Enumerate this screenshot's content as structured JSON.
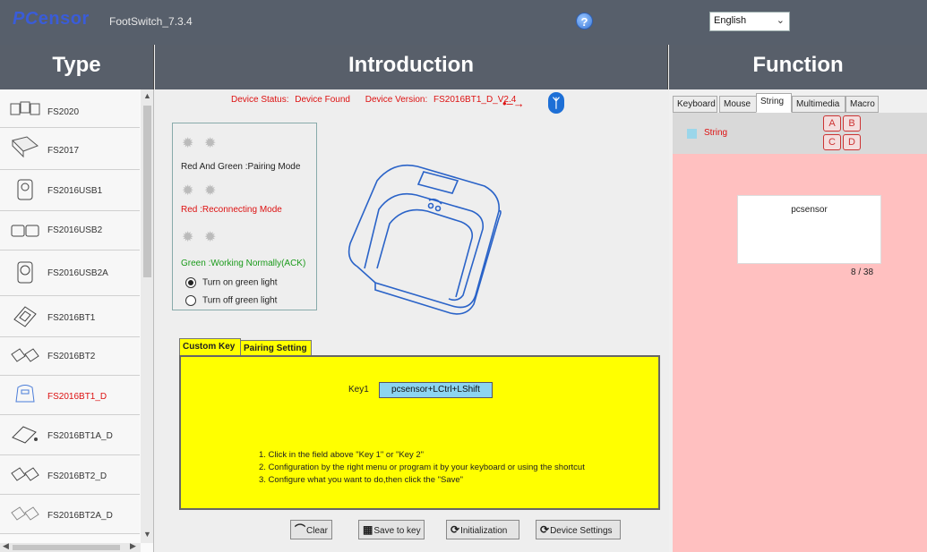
{
  "titlebar": {
    "logo_pc": "PC",
    "logo_rest": "ensor",
    "app_title": "FootSwitch_7.3.4",
    "language": "English"
  },
  "headers": {
    "type": "Type",
    "introduction": "Introduction",
    "function": "Function"
  },
  "devices": [
    {
      "name": "FS2020"
    },
    {
      "name": "FS2017"
    },
    {
      "name": "FS2016USB1"
    },
    {
      "name": "FS2016USB2"
    },
    {
      "name": "FS2016USB2A"
    },
    {
      "name": "FS2016BT1"
    },
    {
      "name": "FS2016BT2"
    },
    {
      "name": "FS2016BT1_D",
      "active": true
    },
    {
      "name": "FS2016BT1A_D"
    },
    {
      "name": "FS2016BT2_D"
    },
    {
      "name": "FS2016BT2A_D"
    }
  ],
  "status": {
    "device_status_label": "Device Status:",
    "device_status_value": "Device Found",
    "device_version_label": "Device Version:",
    "device_version_value": "FS2016BT1_D_V2.4"
  },
  "leds": {
    "pairing": "Red And Green :Pairing Mode",
    "reconnecting": "Red :Reconnecting Mode",
    "working": "Green :Working Normally(ACK)",
    "turn_on": "Turn on green light",
    "turn_off": "Turn off green light",
    "selected": "turn_on"
  },
  "tabs": {
    "custom_key": "Custom Key",
    "pairing_setting": "Pairing Setting"
  },
  "custom_key": {
    "key_label": "Key1",
    "key_value": "pcsensor+LCtrl+LShift",
    "instructions": [
      "1. Click in the field above \"Key 1\" or \"Key 2\"",
      "2. Configuration by the right menu or program it by your keyboard or using the shortcut",
      "3. Configure what you want to do,then click the \"Save\""
    ]
  },
  "buttons": {
    "clear": "Clear",
    "save_to_key": "Save to key",
    "initialization": "Initialization",
    "device_settings": "Device Settings"
  },
  "function": {
    "tabs": [
      "Keyboard",
      "Mouse",
      "String",
      "Multimedia",
      "Macro"
    ],
    "active_tab": "String",
    "string_label": "String",
    "slots": [
      "A",
      "B",
      "C",
      "D"
    ],
    "string_value": "pcsensor",
    "count": "8 / 38"
  },
  "colors": {
    "titlebar": "#575f6b",
    "accent_red": "#d11111",
    "yellow": "#ffff00",
    "pink": "#ffc0c0",
    "key_field": "#8cd4f0"
  }
}
